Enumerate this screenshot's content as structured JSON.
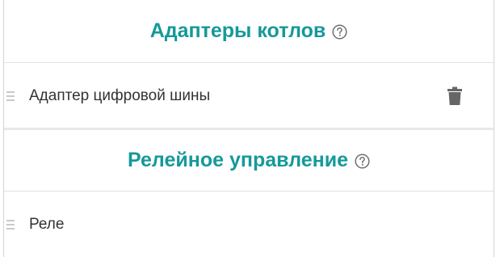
{
  "sections": [
    {
      "title": "Адаптеры котлов",
      "help_icon": "help-circle-icon",
      "items": [
        {
          "label": "Адаптер цифровой шины",
          "has_delete": true,
          "delete_icon": "trash-icon",
          "drag_icon": "drag-handle-icon"
        }
      ]
    },
    {
      "title": "Релейное управление",
      "help_icon": "help-circle-icon",
      "items": [
        {
          "label": "Реле",
          "has_delete": false,
          "drag_icon": "drag-handle-icon"
        }
      ]
    }
  ],
  "colors": {
    "title_accent": "#15999a",
    "text": "#333333",
    "trash": "#666666",
    "drag_handle": "#c9c9c9"
  }
}
